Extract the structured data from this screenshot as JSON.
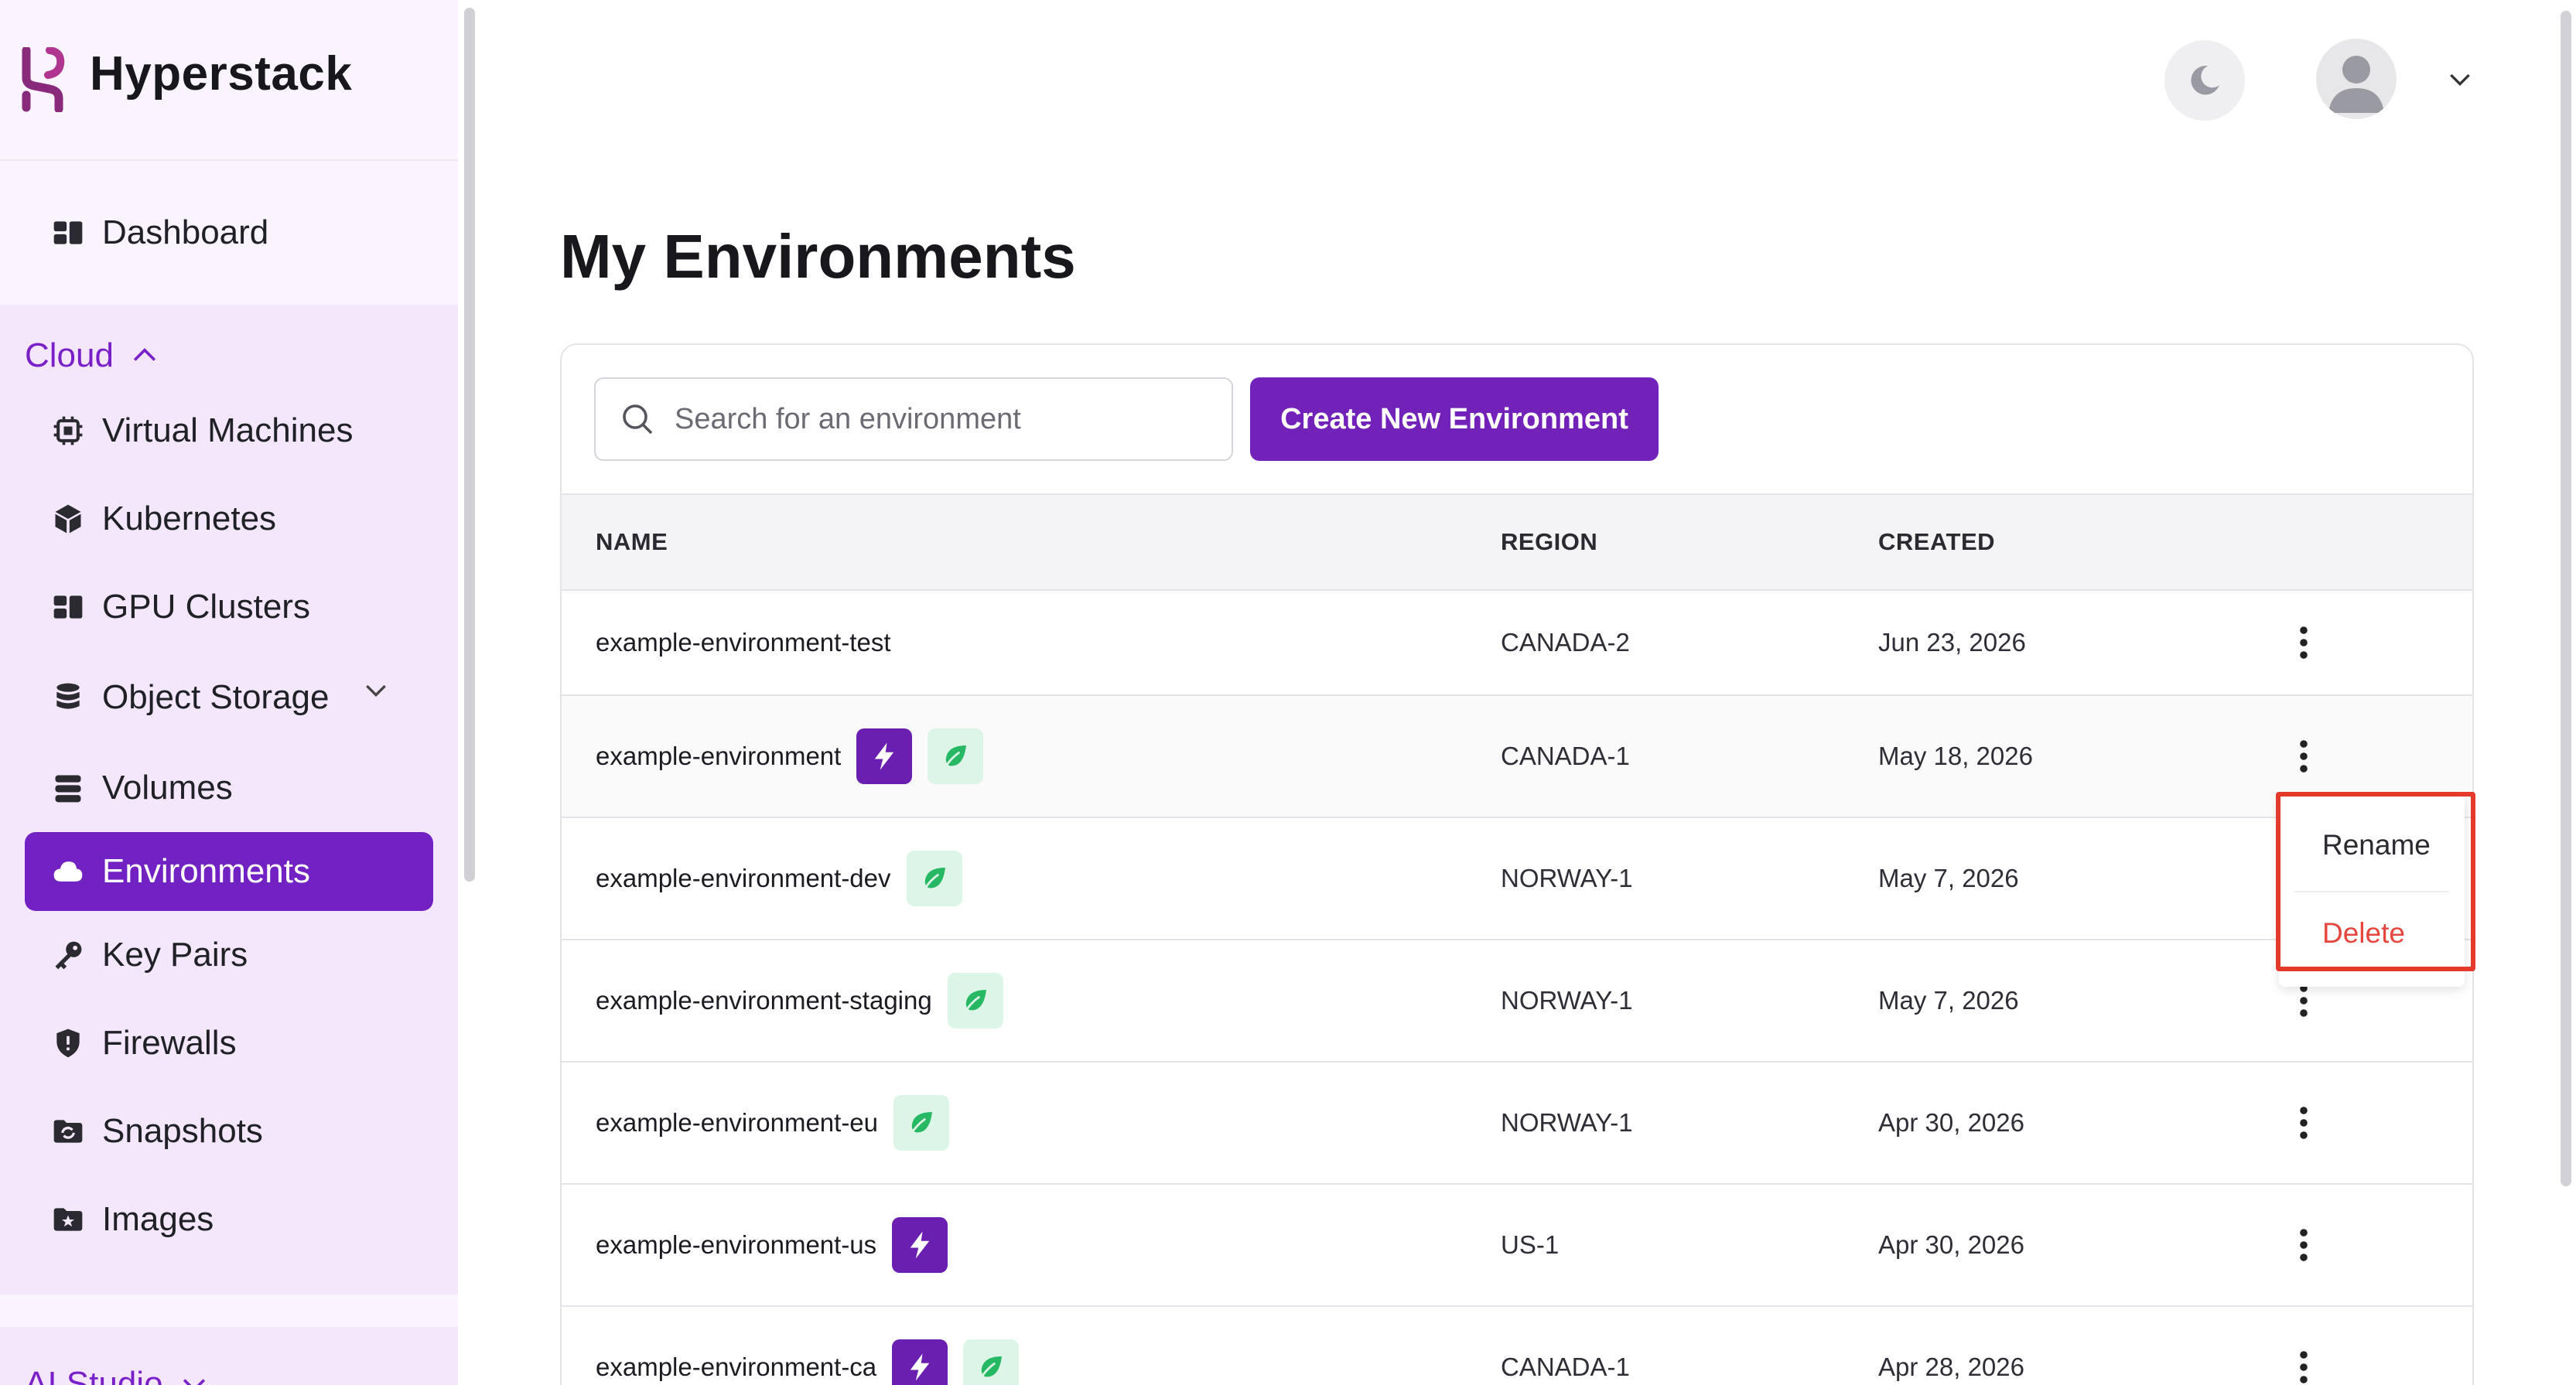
{
  "brand": {
    "name": "Hyperstack",
    "logo_icon": "hyperstack-logo-icon",
    "accent": "#7222c2"
  },
  "sidebar": {
    "dashboard": {
      "label": "Dashboard",
      "icon": "dashboard-icon"
    },
    "cloud_group": {
      "label": "Cloud",
      "expanded": true,
      "items": [
        {
          "label": "Virtual Machines",
          "icon": "chip-icon"
        },
        {
          "label": "Kubernetes",
          "icon": "cube-icon"
        },
        {
          "label": "GPU Clusters",
          "icon": "cluster-icon"
        },
        {
          "label": "Object Storage",
          "icon": "database-icon",
          "has_submenu": true
        },
        {
          "label": "Volumes",
          "icon": "volumes-icon"
        },
        {
          "label": "Environments",
          "icon": "cloud-icon",
          "active": true
        },
        {
          "label": "Key Pairs",
          "icon": "key-icon"
        },
        {
          "label": "Firewalls",
          "icon": "shield-icon"
        },
        {
          "label": "Snapshots",
          "icon": "snapshot-icon"
        },
        {
          "label": "Images",
          "icon": "image-icon"
        }
      ]
    },
    "ai_group": {
      "label": "AI Studio",
      "expanded": false
    }
  },
  "header": {
    "theme_toggle_icon": "moon-icon",
    "avatar_icon": "user-avatar-icon"
  },
  "main": {
    "title": "My Environments",
    "search": {
      "placeholder": "Search for an environment",
      "value": ""
    },
    "create_button": "Create New Environment",
    "table": {
      "columns": [
        "NAME",
        "REGION",
        "CREATED"
      ],
      "rows": [
        {
          "name": "example-environment-test",
          "region": "CANADA-2",
          "created": "Jun 23, 2026",
          "badges": []
        },
        {
          "name": "example-environment",
          "region": "CANADA-1",
          "created": "May 18, 2026",
          "badges": [
            "bolt",
            "leaf"
          ]
        },
        {
          "name": "example-environment-dev",
          "region": "NORWAY-1",
          "created": "May 7, 2026",
          "badges": [
            "leaf"
          ]
        },
        {
          "name": "example-environment-staging",
          "region": "NORWAY-1",
          "created": "May 7, 2026",
          "badges": [
            "leaf"
          ]
        },
        {
          "name": "example-environment-eu",
          "region": "NORWAY-1",
          "created": "Apr 30, 2026",
          "badges": [
            "leaf"
          ]
        },
        {
          "name": "example-environment-us",
          "region": "US-1",
          "created": "Apr 30, 2026",
          "badges": [
            "bolt"
          ]
        },
        {
          "name": "example-environment-ca",
          "region": "CANADA-1",
          "created": "Apr 28, 2026",
          "badges": [
            "bolt",
            "leaf"
          ]
        }
      ]
    },
    "row_menu": {
      "rename": "Rename",
      "delete": "Delete",
      "delete_color": "#e5473f"
    }
  }
}
